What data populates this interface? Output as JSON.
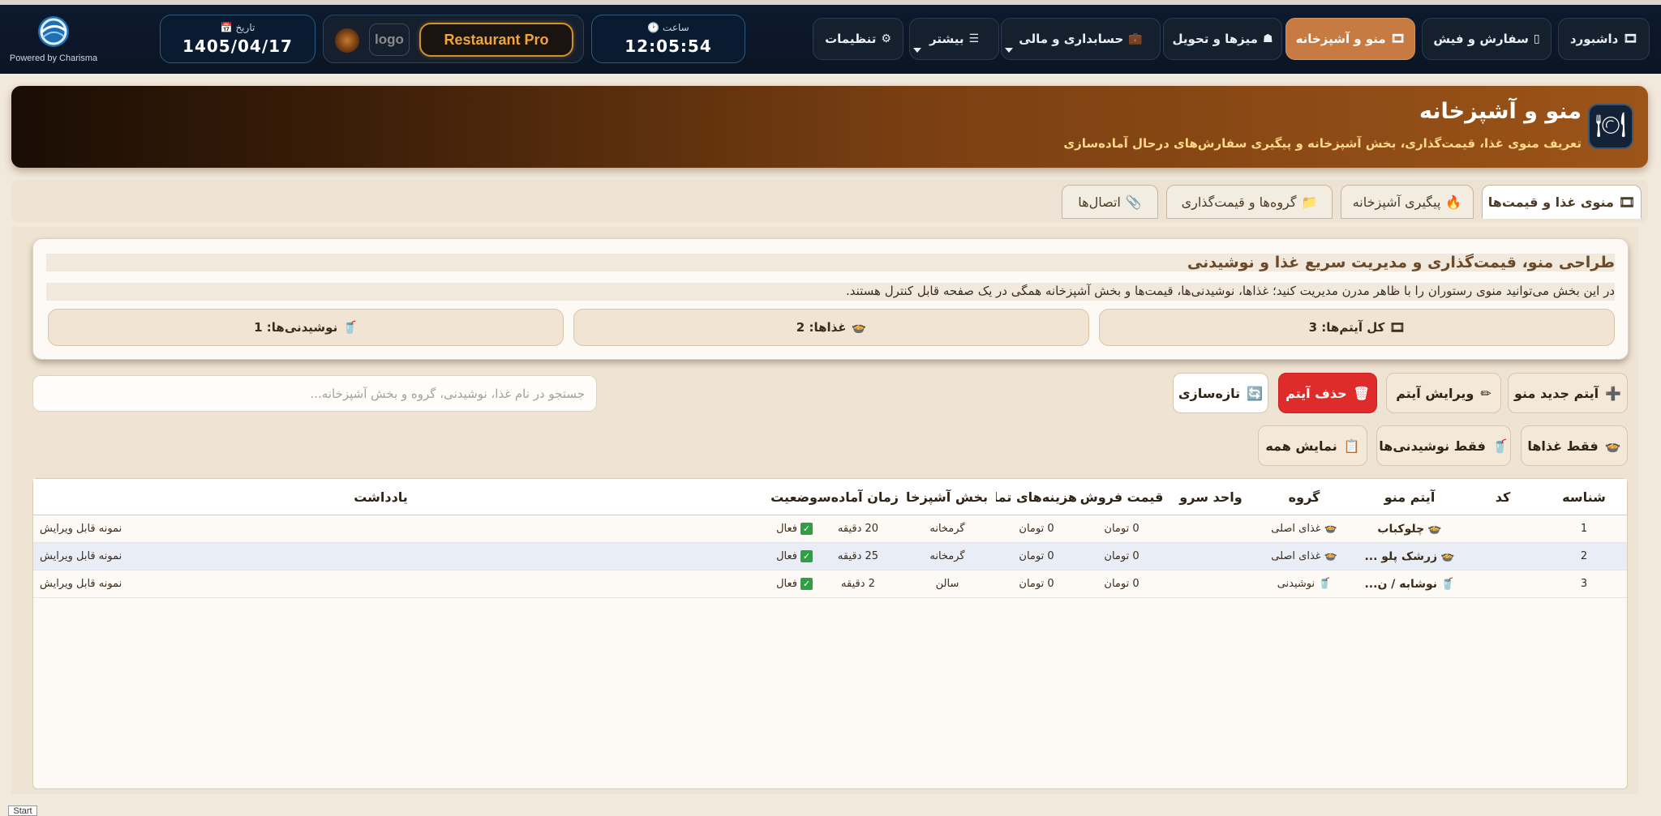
{
  "brand": {
    "powered": "Powered by Charisma"
  },
  "date": {
    "label": "📅 تاریخ",
    "value": "1405/04/17"
  },
  "logo": {
    "text": "logo"
  },
  "product": {
    "name": "Restaurant Pro"
  },
  "clock": {
    "label": "🕑 ساعت",
    "value": "12:05:54"
  },
  "nav": [
    {
      "label": "داشبورد",
      "icon": "🎞"
    },
    {
      "label": "سفارش و فیش",
      "icon": "▯"
    },
    {
      "label": "منو و آشپزخانه",
      "icon": "🎞"
    },
    {
      "label": "میزها و تحویل",
      "icon": "☗"
    },
    {
      "label": "حسابداری و مالی",
      "icon": "💼"
    },
    {
      "label": "بیشتر",
      "icon": "☰"
    },
    {
      "label": "تنظیمات",
      "icon": "⚙"
    }
  ],
  "header": {
    "title": "منو و آشپزخانه",
    "subtitle": "تعریف منوی غذا، قیمت‌گذاری، بخش آشپزخانه و پیگیری سفارش‌های درحال آماده‌سازی"
  },
  "tabs": [
    {
      "label": "منوی غذا و قیمت‌ها",
      "icon": "🎞"
    },
    {
      "label": "پیگیری آشپزخانه",
      "icon": "🔥"
    },
    {
      "label": "گروه‌ها و قیمت‌گذاری",
      "icon": "📁"
    },
    {
      "label": "اتصال‌ها",
      "icon": "📎"
    }
  ],
  "intro": {
    "title": "طراحی منو، قیمت‌گذاری و مدیریت سریع غذا و نوشیدنی",
    "desc": "در این بخش می‌توانید منوی رستوران را با ظاهر مدرن مدیریت کنید؛ غذاها، نوشیدنی‌ها، قیمت‌ها و بخش آشپزخانه همگی در یک صفحه قابل کنترل هستند."
  },
  "stats": [
    {
      "icon": "🎞",
      "label": "کل آیتم‌ها: 3"
    },
    {
      "icon": "🍲",
      "label": "غذاها: 2"
    },
    {
      "icon": "🥤",
      "label": "نوشیدنی‌ها: 1"
    }
  ],
  "toolbar": {
    "new_item": "آیتم جدید منو",
    "edit_item": "ویرایش آیتم",
    "delete_item": "حذف آیتم",
    "refresh": "تازه‌سازی",
    "only_food": "فقط غذاها",
    "only_drinks": "فقط نوشیدنی‌ها",
    "show_all": "نمایش همه",
    "search_placeholder": "جستجو در نام غذا، نوشیدنی، گروه و بخش آشپزخانه..."
  },
  "table": {
    "headers": {
      "id": "شناسه",
      "code": "کد",
      "item": "آیتم منو",
      "group": "گروه",
      "unit": "واحد سرو",
      "price": "قیمت فروش",
      "cost": "هزینه‌های تمام‌شده",
      "kitchen": "بخش آشپزخانه",
      "prep": "زمان آماده‌سازی",
      "status": "وضعیت",
      "note": "یادداشت"
    },
    "rows": [
      {
        "id": "1",
        "code": "",
        "item": "چلوکباب",
        "item_icon": "🍲",
        "group": "غذای اصلی",
        "group_icon": "🍲",
        "unit": "",
        "price": "0 تومان",
        "cost": "0 تومان",
        "kitchen": "گرمخانه",
        "prep": "20 دقیقه",
        "status": "فعال",
        "note": "نمونه قابل ویرایش"
      },
      {
        "id": "2",
        "code": "",
        "item": "زرشک پلو ...",
        "item_icon": "🍲",
        "group": "غذای اصلی",
        "group_icon": "🍲",
        "unit": "",
        "price": "0 تومان",
        "cost": "0 تومان",
        "kitchen": "گرمخانه",
        "prep": "25 دقیقه",
        "status": "فعال",
        "note": "نمونه قابل ویرایش"
      },
      {
        "id": "3",
        "code": "",
        "item": "نوشابه / ن...",
        "item_icon": "🥤",
        "group": "نوشیدنی",
        "group_icon": "🥤",
        "unit": "",
        "price": "0 تومان",
        "cost": "0 تومان",
        "kitchen": "سالن",
        "prep": "2 دقیقه",
        "status": "فعال",
        "note": "نمونه قابل ویرایش"
      }
    ]
  },
  "taskbar": {
    "start": "Start"
  },
  "colors": {
    "accent": "#c77b43",
    "danger": "#e02b2b",
    "nav_bg": "#0d1a2e",
    "banner": "#9c5418",
    "pro_gold": "#f2a534"
  }
}
